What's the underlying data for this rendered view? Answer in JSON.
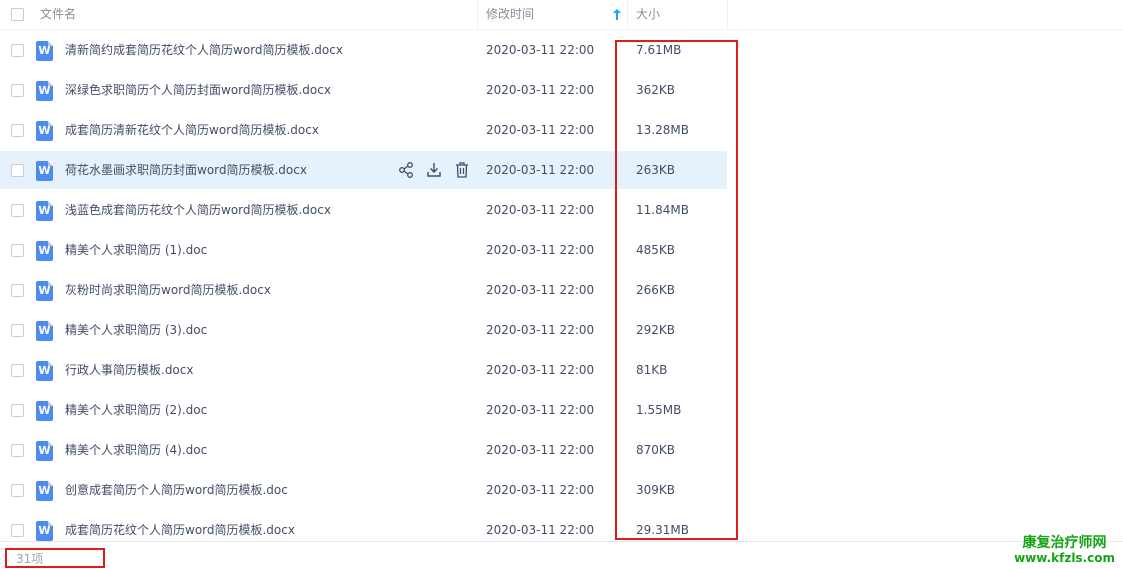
{
  "header": {
    "name_label": "文件名",
    "time_label": "修改时间",
    "size_label": "大小"
  },
  "files": [
    {
      "name": "清新简约成套简历花纹个人简历word简历模板.docx",
      "time": "2020-03-11 22:00",
      "size": "7.61MB"
    },
    {
      "name": "深绿色求职简历个人简历封面word简历模板.docx",
      "time": "2020-03-11 22:00",
      "size": "362KB"
    },
    {
      "name": "成套简历清新花纹个人简历word简历模板.docx",
      "time": "2020-03-11 22:00",
      "size": "13.28MB"
    },
    {
      "name": "荷花水墨画求职简历封面word简历模板.docx",
      "time": "2020-03-11 22:00",
      "size": "263KB"
    },
    {
      "name": "浅蓝色成套简历花纹个人简历word简历模板.docx",
      "time": "2020-03-11 22:00",
      "size": "11.84MB"
    },
    {
      "name": "精美个人求职简历 (1).doc",
      "time": "2020-03-11 22:00",
      "size": "485KB"
    },
    {
      "name": "灰粉时尚求职简历word简历模板.docx",
      "time": "2020-03-11 22:00",
      "size": "266KB"
    },
    {
      "name": "精美个人求职简历 (3).doc",
      "time": "2020-03-11 22:00",
      "size": "292KB"
    },
    {
      "name": "行政人事简历模板.docx",
      "time": "2020-03-11 22:00",
      "size": "81KB"
    },
    {
      "name": "精美个人求职简历 (2).doc",
      "time": "2020-03-11 22:00",
      "size": "1.55MB"
    },
    {
      "name": "精美个人求职简历 (4).doc",
      "time": "2020-03-11 22:00",
      "size": "870KB"
    },
    {
      "name": "创意成套简历个人简历word简历模板.doc",
      "time": "2020-03-11 22:00",
      "size": "309KB"
    },
    {
      "name": "成套简历花纹个人简历word简历模板.docx",
      "time": "2020-03-11 22:00",
      "size": "29.31MB"
    }
  ],
  "file_icon_letter": "W",
  "icons": {
    "share": "share-icon",
    "download": "download-icon",
    "delete": "trash-icon",
    "sort": "sort-arrow-up-icon"
  },
  "footer": {
    "count": "31项"
  },
  "watermark": {
    "line1": "康复治疗师网",
    "line2": "www.kfzls.com"
  },
  "colors": {
    "file_icon": "#4d8bf0",
    "row_hover": "#e5f2fb",
    "sort_arrow": "#09aaff",
    "highlight_box": "#e01b1b",
    "watermark": "#17a317"
  }
}
